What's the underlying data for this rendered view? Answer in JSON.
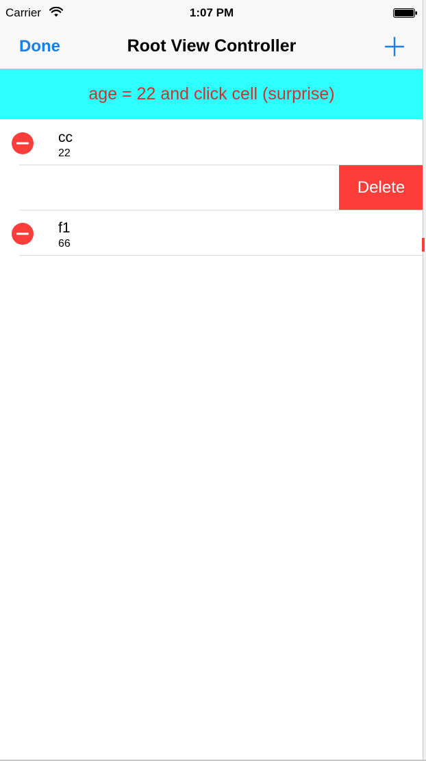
{
  "status_bar": {
    "carrier": "Carrier",
    "time": "1:07 PM",
    "icons": [
      "wifi-icon",
      "battery-icon"
    ]
  },
  "nav_bar": {
    "left_button": "Done",
    "title": "Root View Controller",
    "right_icon": "plus-icon"
  },
  "banner": {
    "text": "age = 22 and click cell (surprise)",
    "background": "#2dffff",
    "text_color": "#cc3333"
  },
  "table": {
    "rows": [
      {
        "title": "cc",
        "subtitle": "22",
        "editing_icon": "minus-circle-icon"
      },
      {
        "title": "",
        "subtitle": "",
        "action": "Delete"
      },
      {
        "title": "f1",
        "subtitle": "66",
        "editing_icon": "minus-circle-icon"
      }
    ]
  },
  "colors": {
    "tint": "#1a7ef0",
    "destructive": "#fc3d39"
  }
}
